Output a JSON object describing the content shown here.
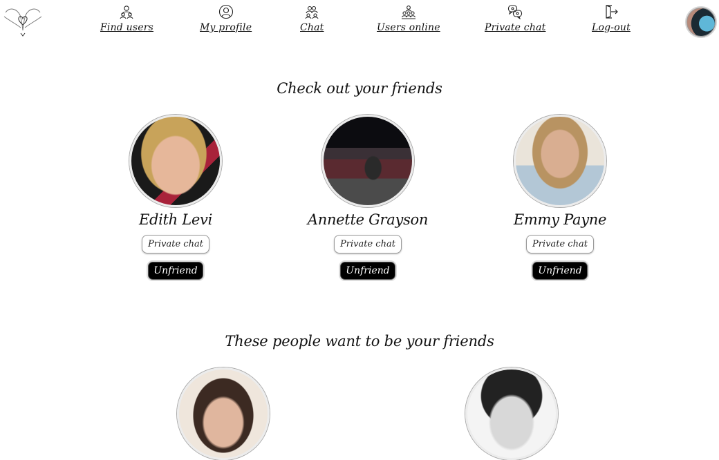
{
  "nav": {
    "items": [
      {
        "label": "Find users",
        "icon": "users-search-icon"
      },
      {
        "label": "My profile",
        "icon": "profile-icon"
      },
      {
        "label": "Chat",
        "icon": "chat-group-icon"
      },
      {
        "label": "Users online",
        "icon": "users-online-icon"
      },
      {
        "label": "Private chat",
        "icon": "private-chat-icon"
      },
      {
        "label": "Log-out",
        "icon": "logout-icon"
      }
    ]
  },
  "friends_section": {
    "title": "Check out your friends",
    "friends": [
      {
        "name": "Edith Levi",
        "private_chat_label": "Private chat",
        "unfriend_label": "Unfriend"
      },
      {
        "name": "Annette Grayson",
        "private_chat_label": "Private chat",
        "unfriend_label": "Unfriend"
      },
      {
        "name": "Emmy Payne",
        "private_chat_label": "Private chat",
        "unfriend_label": "Unfriend"
      }
    ]
  },
  "requests_section": {
    "title": "These people want to be your friends"
  },
  "colors": {
    "background": "#ffffff",
    "text": "#111111",
    "unfriend_button": "#000000"
  }
}
